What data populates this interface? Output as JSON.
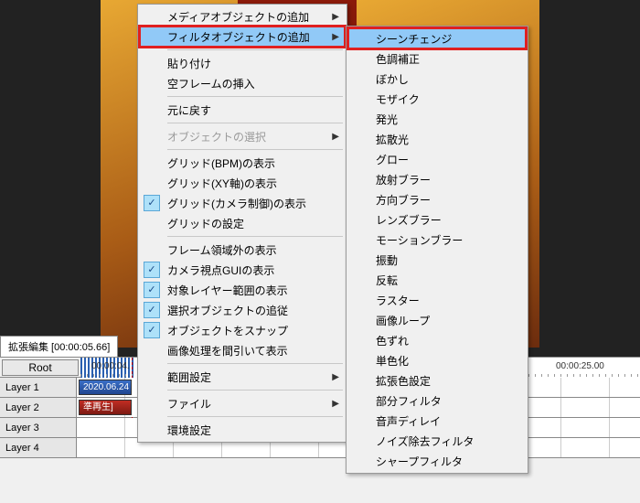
{
  "timeline": {
    "title": "拡張編集 [00:00:05.66]",
    "root_button": "Root",
    "ruler": {
      "t1": "00:00:04.",
      "t2": "00:00:25.00"
    },
    "layers": [
      {
        "label": "Layer 1",
        "clip_label": "2020.06.24 -",
        "clip_class": "blue"
      },
      {
        "label": "Layer 2",
        "clip_label": "準再生]",
        "clip_class": "red"
      },
      {
        "label": "Layer 3",
        "clip_label": "",
        "clip_class": ""
      },
      {
        "label": "Layer 4",
        "clip_label": "",
        "clip_class": ""
      }
    ]
  },
  "menu_main": [
    {
      "label": "メディアオブジェクトの追加",
      "arrow": true
    },
    {
      "label": "フィルタオブジェクトの追加",
      "arrow": true,
      "hl": true,
      "box": true
    },
    {
      "sep": true
    },
    {
      "label": "貼り付け"
    },
    {
      "label": "空フレームの挿入"
    },
    {
      "sep": true
    },
    {
      "label": "元に戻す"
    },
    {
      "sep": true
    },
    {
      "label": "オブジェクトの選択",
      "arrow": true,
      "disabled": true
    },
    {
      "sep": true
    },
    {
      "label": "グリッド(BPM)の表示"
    },
    {
      "label": "グリッド(XY軸)の表示"
    },
    {
      "label": "グリッド(カメラ制御)の表示",
      "checked": true
    },
    {
      "label": "グリッドの設定"
    },
    {
      "sep": true
    },
    {
      "label": "フレーム領域外の表示"
    },
    {
      "label": "カメラ視点GUIの表示",
      "checked": true
    },
    {
      "label": "対象レイヤー範囲の表示",
      "checked": true
    },
    {
      "label": "選択オブジェクトの追従",
      "checked": true
    },
    {
      "label": "オブジェクトをスナップ",
      "checked": true
    },
    {
      "label": "画像処理を間引いて表示"
    },
    {
      "sep": true
    },
    {
      "label": "範囲設定",
      "arrow": true
    },
    {
      "sep": true
    },
    {
      "label": "ファイル",
      "arrow": true
    },
    {
      "sep": true
    },
    {
      "label": "環境設定"
    }
  ],
  "menu_sub": [
    {
      "label": "シーンチェンジ",
      "hl": true,
      "box": true
    },
    {
      "label": "色調補正"
    },
    {
      "label": "ぼかし"
    },
    {
      "label": "モザイク"
    },
    {
      "label": "発光"
    },
    {
      "label": "拡散光"
    },
    {
      "label": "グロー"
    },
    {
      "label": "放射ブラー"
    },
    {
      "label": "方向ブラー"
    },
    {
      "label": "レンズブラー"
    },
    {
      "label": "モーションブラー"
    },
    {
      "label": "振動"
    },
    {
      "label": "反転"
    },
    {
      "label": "ラスター"
    },
    {
      "label": "画像ループ"
    },
    {
      "label": "色ずれ"
    },
    {
      "label": "単色化"
    },
    {
      "label": "拡張色設定"
    },
    {
      "label": "部分フィルタ"
    },
    {
      "label": "音声ディレイ"
    },
    {
      "label": "ノイズ除去フィルタ"
    },
    {
      "label": "シャープフィルタ"
    }
  ]
}
